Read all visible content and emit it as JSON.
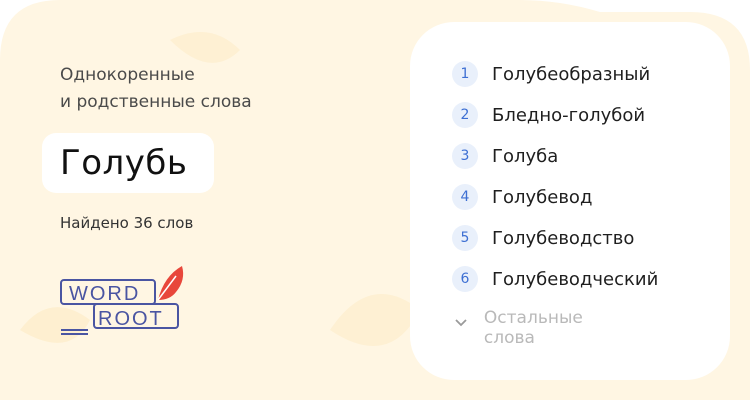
{
  "subtitle": {
    "line1": "Однокоренные",
    "line2": "и родственные слова"
  },
  "word": "Голубь",
  "found_count": "Найдено 36 слов",
  "logo": {
    "line1": "WORD",
    "line2": "ROOT"
  },
  "related_words": [
    {
      "num": "1",
      "word": "Голубеобразный"
    },
    {
      "num": "2",
      "word": "Бледно-голубой"
    },
    {
      "num": "3",
      "word": "Голуба"
    },
    {
      "num": "4",
      "word": "Голубевод"
    },
    {
      "num": "5",
      "word": "Голубеводство"
    },
    {
      "num": "6",
      "word": "Голубеводческий"
    }
  ],
  "more_label": "Остальные слова",
  "colors": {
    "background": "#fff6e3",
    "accent": "#3d6fd3",
    "logo": "#4a55a2",
    "feather": "#e8473b"
  },
  "icons": {
    "chevron": "chevron-down-icon",
    "feather": "feather-icon"
  }
}
